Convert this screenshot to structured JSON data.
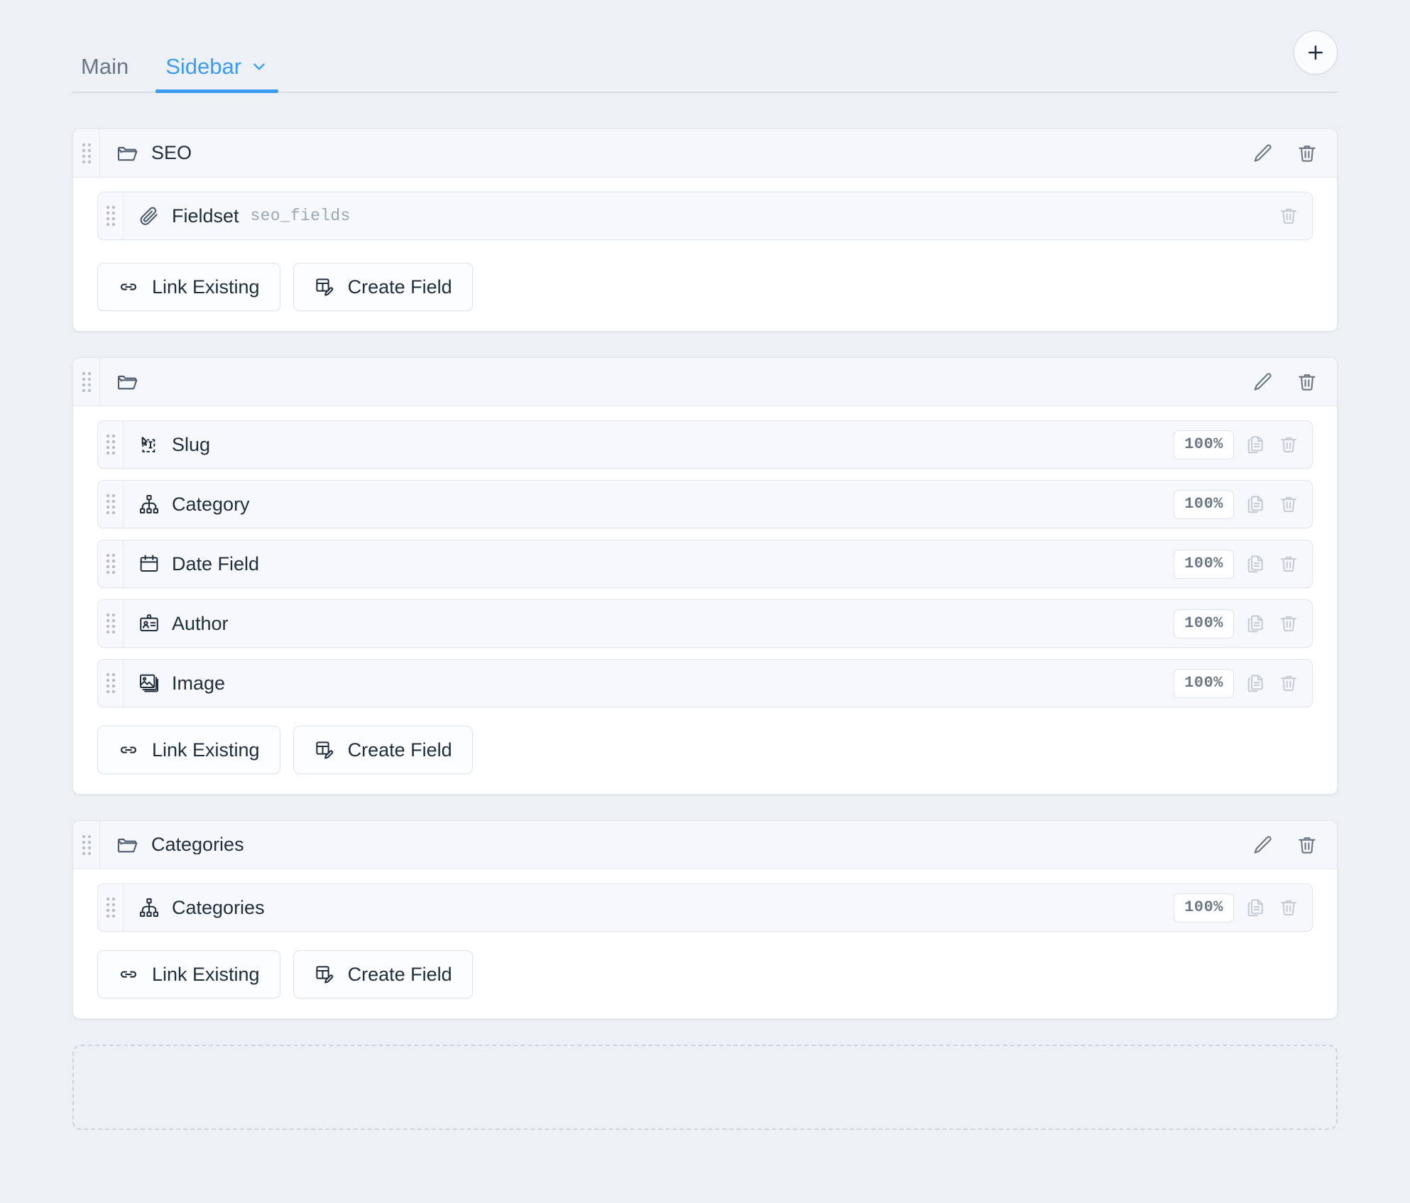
{
  "tabs": [
    {
      "label": "Main",
      "active": false,
      "has_chevron": false
    },
    {
      "label": "Sidebar",
      "active": true,
      "has_chevron": true
    }
  ],
  "add_tab_button": {
    "icon": "plus-icon",
    "label": "+"
  },
  "colors": {
    "accent": "#3b9bf5",
    "page_background": "#edf0f4",
    "card_background": "#ffffff",
    "row_background": "#f6f8fb",
    "text": "#1f2d3d",
    "muted_text": "#9aa7b6",
    "border": "#e2e7ee"
  },
  "buttons": {
    "link_existing": "Link Existing",
    "create_field": "Create Field"
  },
  "row_actions": {
    "duplicate_icon": "copy-icon",
    "delete_icon": "trash-icon",
    "edit_icon": "pencil-icon"
  },
  "groups": [
    {
      "title": "SEO",
      "icon": "folder-icon",
      "fields": [
        {
          "label": "Fieldset",
          "key": "seo_fields",
          "icon": "paperclip-icon",
          "width": null,
          "is_fieldset": true
        }
      ]
    },
    {
      "title": "",
      "icon": "folder-icon",
      "fields": [
        {
          "label": "Slug",
          "key": "",
          "icon": "text-cursor-icon",
          "width": "100%",
          "is_fieldset": false
        },
        {
          "label": "Category",
          "key": "",
          "icon": "hierarchy-icon",
          "width": "100%",
          "is_fieldset": false
        },
        {
          "label": "Date Field",
          "key": "",
          "icon": "calendar-icon",
          "width": "100%",
          "is_fieldset": false
        },
        {
          "label": "Author",
          "key": "",
          "icon": "id-card-icon",
          "width": "100%",
          "is_fieldset": false
        },
        {
          "label": "Image",
          "key": "",
          "icon": "image-icon",
          "width": "100%",
          "is_fieldset": false
        }
      ]
    },
    {
      "title": "Categories",
      "icon": "folder-icon",
      "fields": [
        {
          "label": "Categories",
          "key": "",
          "icon": "hierarchy-icon",
          "width": "100%",
          "is_fieldset": false
        }
      ]
    }
  ],
  "dropzone": {
    "label": ""
  }
}
